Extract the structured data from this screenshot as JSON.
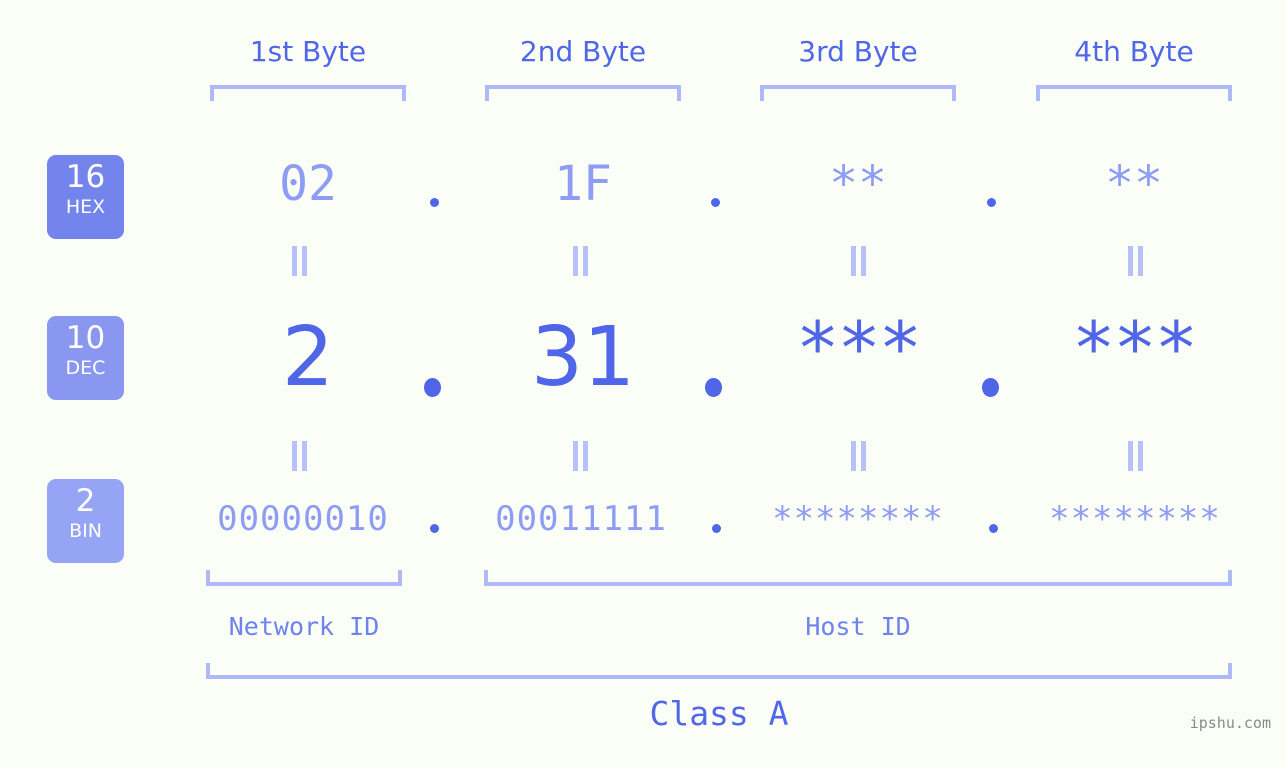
{
  "meta": {
    "background_color": "#fbfdf7",
    "accent_color": "#4e66e7",
    "accent_light_color": "#8e9cf4",
    "bracket_color": "#aebaf7"
  },
  "headers": [
    {
      "label": "1st Byte"
    },
    {
      "label": "2nd Byte"
    },
    {
      "label": "3rd Byte"
    },
    {
      "label": "4th Byte"
    }
  ],
  "rows": [
    {
      "badge_number": "16",
      "badge_name": "HEX",
      "badge_color": "#7484ed",
      "values": [
        "02",
        "1F",
        "**",
        "**"
      ]
    },
    {
      "badge_number": "10",
      "badge_name": "DEC",
      "badge_color": "#8997f1",
      "values": [
        "2",
        "31",
        "***",
        "***"
      ]
    },
    {
      "badge_number": "2",
      "badge_name": "BIN",
      "badge_color": "#96a4f6",
      "values": [
        "00000010",
        "00011111",
        "********",
        "********"
      ]
    }
  ],
  "separators": {
    "glyph": "."
  },
  "equality": {
    "glyph": "="
  },
  "sections": [
    {
      "label": "Network ID"
    },
    {
      "label": "Host ID"
    }
  ],
  "class": {
    "label": "Class A"
  },
  "watermark": {
    "text": "ipshu.com"
  }
}
